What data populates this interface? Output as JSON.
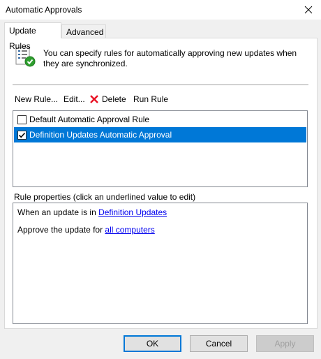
{
  "window": {
    "title": "Automatic Approvals"
  },
  "tabs": [
    {
      "label": "Update Rules",
      "active": true
    },
    {
      "label": "Advanced",
      "active": false
    }
  ],
  "info": {
    "icon": "rules-checklist-icon",
    "text": "You can specify rules for automatically approving new updates when they are synchronized."
  },
  "toolbar": {
    "new_rule": "New Rule...",
    "edit": "Edit...",
    "delete": "Delete",
    "run_rule": "Run Rule"
  },
  "rules": [
    {
      "label": "Default Automatic Approval Rule",
      "checked": false,
      "selected": false
    },
    {
      "label": "Definition Updates Automatic Approval",
      "checked": true,
      "selected": true
    }
  ],
  "properties": {
    "heading": "Rule properties (click an underlined value to edit)",
    "line1_prefix": "When an update is in ",
    "line1_link": "Definition Updates",
    "line2_prefix": "Approve the update for ",
    "line2_link": "all computers"
  },
  "buttons": {
    "ok": "OK",
    "cancel": "Cancel",
    "apply": "Apply",
    "apply_enabled": false
  },
  "colors": {
    "selection": "#0078d7",
    "link": "#0000ee",
    "delete_icon": "#e81123"
  }
}
